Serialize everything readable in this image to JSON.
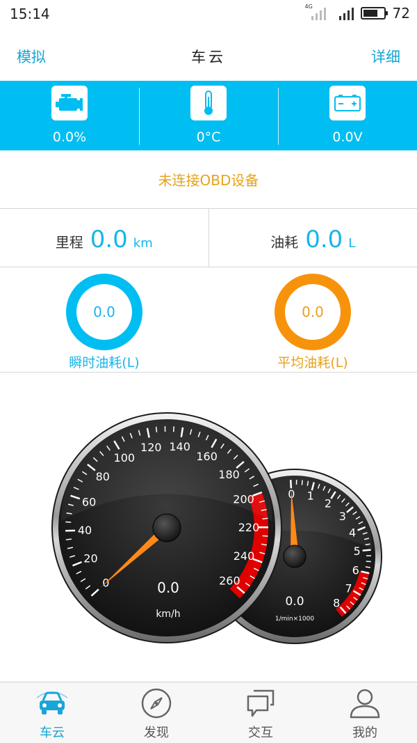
{
  "status_bar": {
    "time": "15:14",
    "network": "4G",
    "battery_level": "72",
    "battery_fraction": 0.72
  },
  "nav": {
    "left": "模拟",
    "title": "车云",
    "right": "详细"
  },
  "sensors": [
    {
      "icon": "engine-icon",
      "value": "0.0%"
    },
    {
      "icon": "thermometer-icon",
      "value": "0°C"
    },
    {
      "icon": "battery-icon",
      "value": "0.0V"
    }
  ],
  "message": "未连接OBD设备",
  "stats": {
    "mileage": {
      "label": "里程",
      "value": "0.0",
      "unit": "km"
    },
    "fuel": {
      "label": "油耗",
      "value": "0.0",
      "unit": "L"
    }
  },
  "rings": {
    "instant": {
      "value": "0.0",
      "label": "瞬时油耗(L)",
      "color": "#00bdf2"
    },
    "average": {
      "value": "0.0",
      "label": "平均油耗(L)",
      "color": "#f7930b"
    }
  },
  "speedometer": {
    "value": "0.0",
    "unit": "km/h",
    "reading": 0,
    "ticks": [
      "0",
      "20",
      "40",
      "60",
      "80",
      "100",
      "120",
      "140",
      "160",
      "180",
      "200",
      "220",
      "240",
      "260"
    ]
  },
  "tachometer": {
    "value": "0.0",
    "unit": "1/min×1000",
    "reading": 0,
    "ticks": [
      "0",
      "1",
      "2",
      "3",
      "4",
      "5",
      "6",
      "7",
      "8"
    ]
  },
  "tabs": [
    {
      "label": "车云",
      "icon": "car-icon",
      "active": true
    },
    {
      "label": "发现",
      "icon": "compass-icon",
      "active": false
    },
    {
      "label": "交互",
      "icon": "chat-icon",
      "active": false
    },
    {
      "label": "我的",
      "icon": "user-icon",
      "active": false
    }
  ],
  "colors": {
    "accent": "#00bdf2",
    "warning": "#e7a11c",
    "orange": "#f7930b",
    "needle": "#ff7a1a",
    "redzone": "#e00000"
  }
}
